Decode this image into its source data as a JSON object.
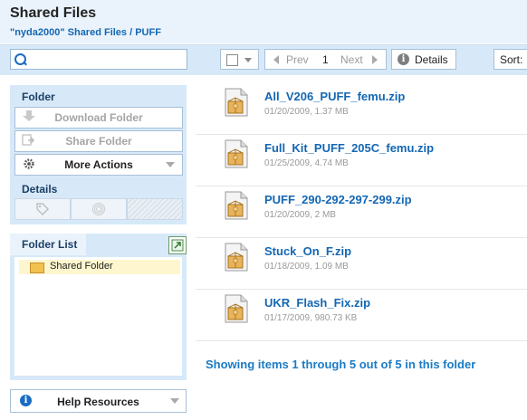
{
  "header": {
    "title": "Shared Files",
    "breadcrumb": "\"nyda2000\" Shared Files / PUFF"
  },
  "toolbar": {
    "search": {
      "value": "",
      "placeholder": ""
    },
    "prev_label": "Prev",
    "page_number": "1",
    "next_label": "Next",
    "details_label": "Details",
    "sort_label": "Sort:"
  },
  "folder_panel": {
    "heading": "Folder",
    "download_label": "Download Folder",
    "share_label": "Share Folder",
    "more_actions_label": "More Actions",
    "details_heading": "Details"
  },
  "folder_list": {
    "tab_label": "Folder List",
    "items": [
      {
        "label": "Shared Folder",
        "selected": true
      }
    ]
  },
  "help": {
    "label": "Help Resources"
  },
  "files": [
    {
      "name": "All_V206_PUFF_femu.zip",
      "meta": "01/20/2009, 1.37 MB"
    },
    {
      "name": "Full_Kit_PUFF_205C_femu.zip",
      "meta": "01/25/2009, 4.74 MB"
    },
    {
      "name": "PUFF_290-292-297-299.zip",
      "meta": "01/20/2009, 2 MB"
    },
    {
      "name": "Stuck_On_F.zip",
      "meta": "01/18/2009, 1.09 MB"
    },
    {
      "name": "UKR_Flash_Fix.zip",
      "meta": "01/17/2009, 980.73 KB"
    }
  ],
  "status_text": "Showing items 1 through 5 out of 5 in this folder",
  "colors": {
    "accent": "#1467b3",
    "panel_bg": "#d7e9f8",
    "header_bg": "#eaf3fb",
    "status_text": "#1b7bc6"
  },
  "icons": [
    "search-icon",
    "chevron-down-icon",
    "arrow-left-icon",
    "arrow-right-icon",
    "info-icon",
    "download-icon",
    "share-icon",
    "gear-icon",
    "tag-icon",
    "fingerprint-icon",
    "popout-icon",
    "folder-icon",
    "zip-file-icon"
  ]
}
